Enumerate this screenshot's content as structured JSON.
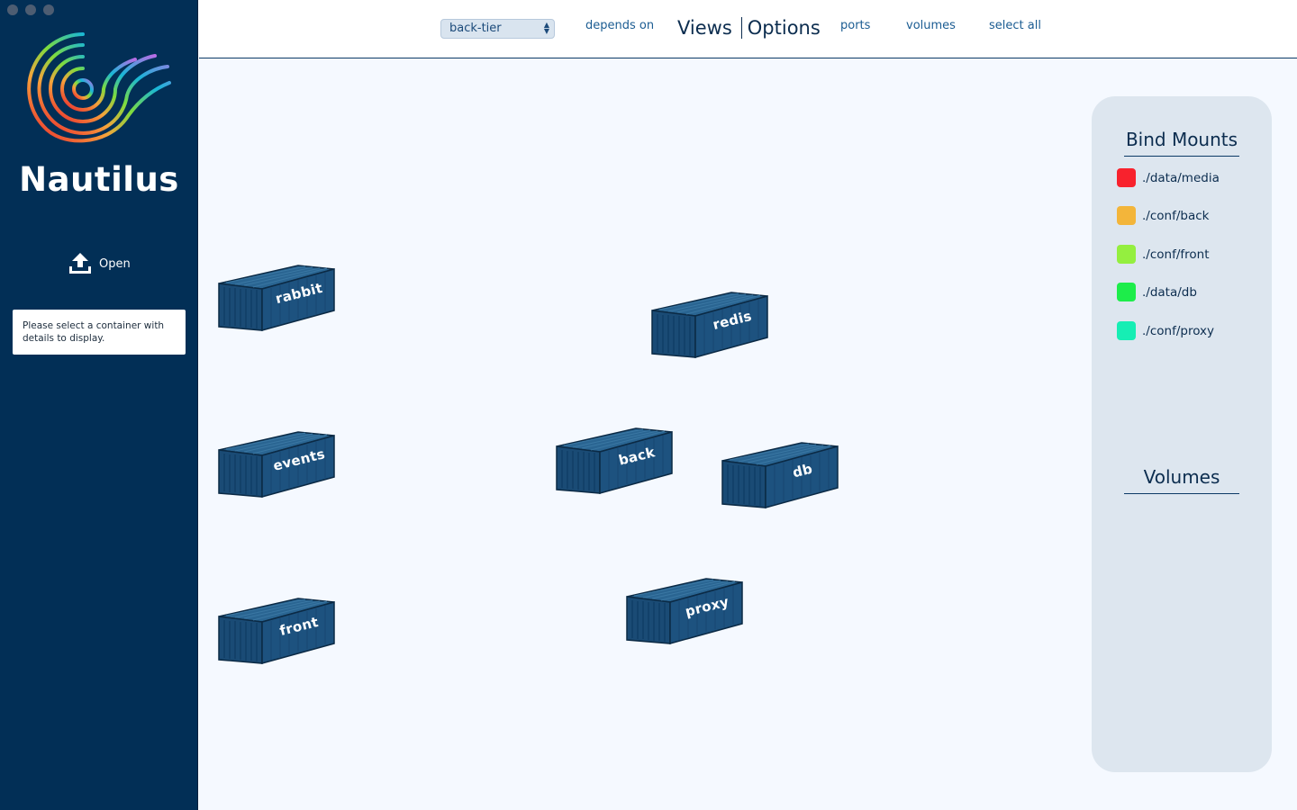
{
  "sidebar": {
    "brand": "Nautilus",
    "open_label": "Open",
    "details_text": "Please select a container with details to display."
  },
  "topbar": {
    "network_select": "back-tier",
    "depends_on": "depends on",
    "views": "Views",
    "options": "Options",
    "ports": "ports",
    "volumes": "volumes",
    "select_all": "select all"
  },
  "containers": {
    "rabbit": "rabbit",
    "redis": "redis",
    "events": "events",
    "back": "back",
    "db": "db",
    "front": "front",
    "proxy": "proxy"
  },
  "right_panel": {
    "bind_mounts_title": "Bind Mounts",
    "volumes_title": "Volumes",
    "mounts": [
      {
        "label": "./data/media",
        "color": "#f8222d"
      },
      {
        "label": "./conf/back",
        "color": "#f3b53a"
      },
      {
        "label": "./conf/front",
        "color": "#94ef3f"
      },
      {
        "label": "./data/db",
        "color": "#1ded4a"
      },
      {
        "label": "./conf/proxy",
        "color": "#16eeb4"
      }
    ]
  },
  "colors": {
    "sidebar_bg": "#022f56",
    "container_fill": "#1a4b75",
    "accent_text": "#1b5c92"
  }
}
